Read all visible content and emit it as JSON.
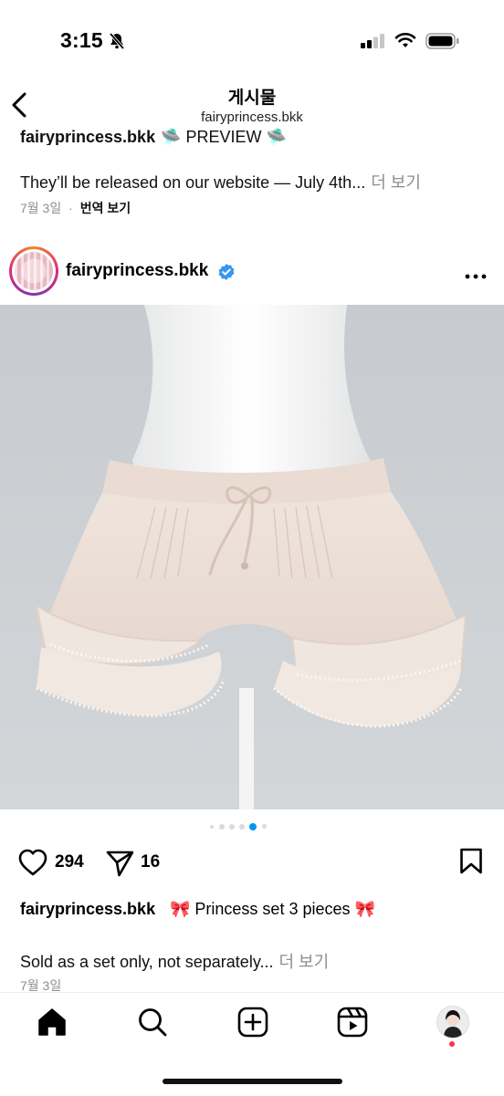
{
  "status_bar": {
    "time": "3:15"
  },
  "header": {
    "title": "게시물",
    "subtitle": "fairyprincess.bkk"
  },
  "prev_post": {
    "username_cut": "fairyprincess.bkk",
    "preview_text": "🛸 PREVIEW 🛸",
    "caption": "They’ll be released on our website — July 4th...",
    "more_label": "더 보기",
    "date": "7월 3일",
    "separator": "·",
    "translate": "번역 보기"
  },
  "post": {
    "username": "fairyprincess.bkk",
    "verified": true,
    "likes": "294",
    "shares": "16",
    "carousel": {
      "count": 6,
      "active_index": 4
    },
    "caption_user": "fairyprincess.bkk",
    "caption_title": "🎀 Princess set 3 pieces 🎀",
    "caption_text": "Sold as a set only, not separately...",
    "more_label": "더 보기",
    "date": "7월 3일"
  },
  "icons": {
    "back": "chevron-left-icon",
    "more": "more-dots-icon",
    "like": "heart-icon",
    "share": "send-icon",
    "save": "bookmark-icon",
    "home": "home-icon",
    "search": "search-icon",
    "create": "plus-square-icon",
    "reels": "reels-icon"
  },
  "colors": {
    "verified": "#3897f0",
    "muted": "#8e8e8e",
    "notif": "#ff3040",
    "active_dot": "#0095f6"
  }
}
